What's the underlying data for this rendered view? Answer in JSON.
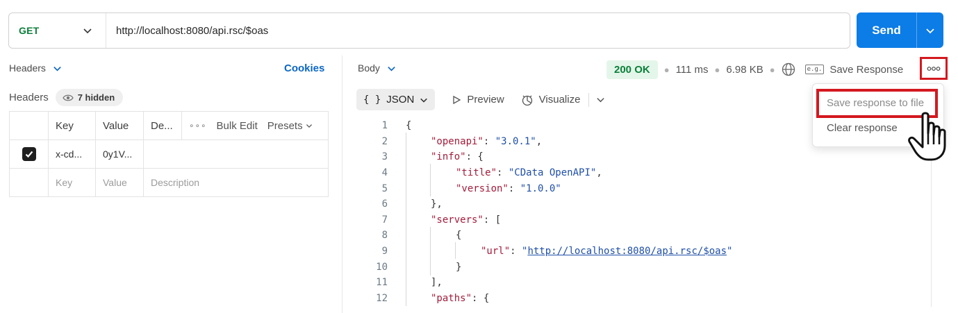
{
  "request": {
    "method": "GET",
    "url": "http://localhost:8080/api.rsc/$oas",
    "send_label": "Send"
  },
  "left": {
    "tab_label": "Headers",
    "cookies_label": "Cookies",
    "headers_title": "Headers",
    "hidden_label": "7 hidden",
    "table": {
      "columns": [
        "Key",
        "Value",
        "De..."
      ],
      "bulk_edit": "Bulk Edit",
      "presets": "Presets",
      "rows": [
        {
          "checked": true,
          "key": "x-cd...",
          "value": "0y1V...",
          "description": ""
        }
      ],
      "placeholder": {
        "key": "Key",
        "value": "Value",
        "description": "Description"
      }
    }
  },
  "response": {
    "body_tab": "Body",
    "status": "200 OK",
    "time": "111 ms",
    "size": "6.98 KB",
    "save_response_badge": "e.g.",
    "save_response_label": "Save Response",
    "views": {
      "json": "JSON",
      "json_glyph": "{ }",
      "preview": "Preview",
      "visualize": "Visualize"
    },
    "menu": {
      "save_to_file": "Save response to file",
      "clear": "Clear response"
    }
  },
  "code_lines": [
    {
      "n": "1",
      "indent": 0,
      "parts": [
        [
          "p",
          "{"
        ]
      ]
    },
    {
      "n": "2",
      "indent": 1,
      "parts": [
        [
          "k",
          "\"openapi\""
        ],
        [
          "p",
          ": "
        ],
        [
          "s",
          "\"3.0.1\""
        ],
        [
          "p",
          ","
        ]
      ]
    },
    {
      "n": "3",
      "indent": 1,
      "parts": [
        [
          "k",
          "\"info\""
        ],
        [
          "p",
          ": {"
        ]
      ]
    },
    {
      "n": "4",
      "indent": 2,
      "parts": [
        [
          "k",
          "\"title\""
        ],
        [
          "p",
          ": "
        ],
        [
          "s",
          "\"CData OpenAPI\""
        ],
        [
          "p",
          ","
        ]
      ]
    },
    {
      "n": "5",
      "indent": 2,
      "parts": [
        [
          "k",
          "\"version\""
        ],
        [
          "p",
          ": "
        ],
        [
          "s",
          "\"1.0.0\""
        ]
      ]
    },
    {
      "n": "6",
      "indent": 1,
      "parts": [
        [
          "p",
          "},"
        ]
      ]
    },
    {
      "n": "7",
      "indent": 1,
      "parts": [
        [
          "k",
          "\"servers\""
        ],
        [
          "p",
          ": ["
        ]
      ]
    },
    {
      "n": "8",
      "indent": 2,
      "parts": [
        [
          "p",
          "{"
        ]
      ]
    },
    {
      "n": "9",
      "indent": 3,
      "parts": [
        [
          "k",
          "\"url\""
        ],
        [
          "p",
          ": "
        ],
        [
          "s",
          "\""
        ],
        [
          "u",
          "http://localhost:8080/api.rsc/$oas"
        ],
        [
          "s",
          "\""
        ]
      ]
    },
    {
      "n": "10",
      "indent": 2,
      "parts": [
        [
          "p",
          "}"
        ]
      ]
    },
    {
      "n": "11",
      "indent": 1,
      "parts": [
        [
          "p",
          "],"
        ]
      ]
    },
    {
      "n": "12",
      "indent": 1,
      "parts": [
        [
          "k",
          "\"paths\""
        ],
        [
          "p",
          ": {"
        ]
      ]
    }
  ],
  "colors": {
    "accent": "#0c7ce6",
    "method": "#0b7f3a",
    "status_bg": "#e4f6e9",
    "highlight": "#d4181f"
  }
}
